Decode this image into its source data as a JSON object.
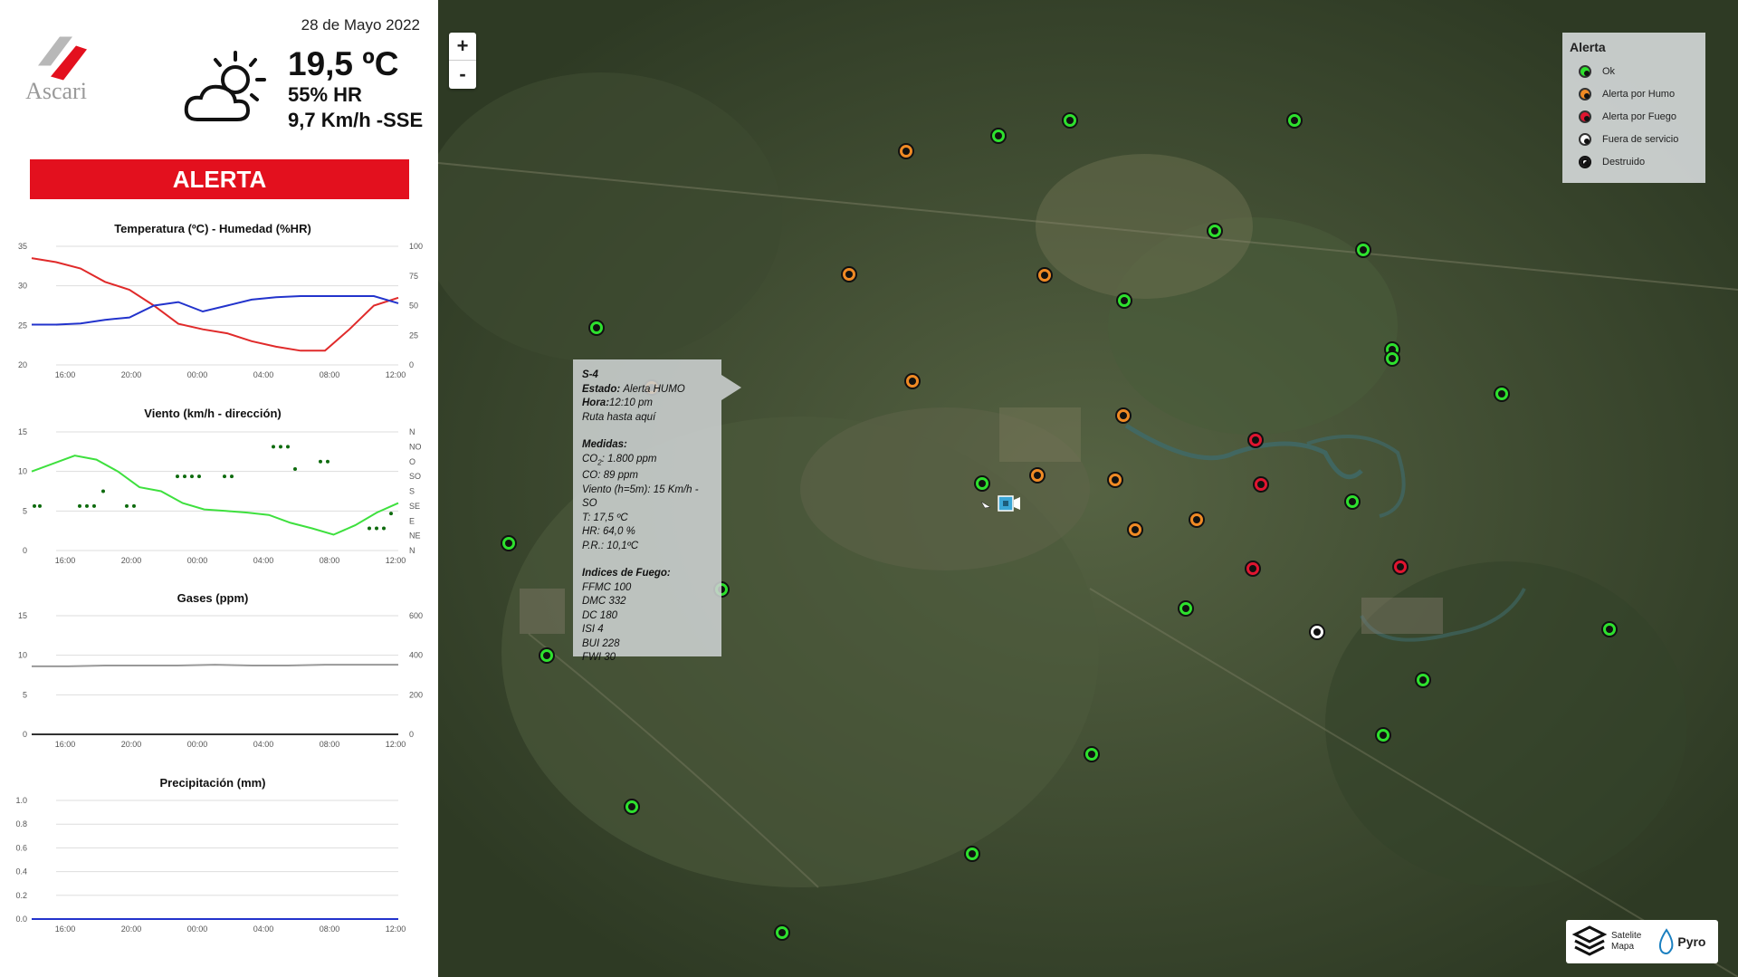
{
  "header": {
    "logo_text": "Ascari",
    "date": "28 de Mayo 2022",
    "temperature": "19,5 ºC",
    "humidity": "55% HR",
    "wind": "9,7 Km/h -SSE",
    "weather_icon": "partly-cloudy-icon"
  },
  "alert_banner": {
    "label": "ALERTA",
    "color": "#e3101e"
  },
  "charts": {
    "temp_humidity": {
      "title": "Temperatura (ºC) - Humedad (%HR)",
      "type": "line",
      "x_ticks": [
        "16:00",
        "20:00",
        "00:00",
        "04:00",
        "08:00",
        "12:00"
      ],
      "y_left_ticks": [
        "35",
        "30",
        "25",
        "20"
      ],
      "y_right_ticks": [
        "100",
        "75",
        "50",
        "25",
        "0"
      ],
      "series": [
        {
          "name": "Temperatura",
          "color": "#e02a2a",
          "values": [
            33.5,
            33.0,
            32.2,
            30.5,
            29.5,
            27.5,
            25.2,
            24.5,
            24.0,
            23.0,
            22.3,
            21.8,
            21.8,
            24.5,
            27.5,
            28.5
          ]
        },
        {
          "name": "Humedad",
          "color": "#2233cc",
          "values": [
            34,
            34,
            35,
            38,
            40,
            50,
            53,
            45,
            50,
            55,
            57,
            58,
            58,
            58,
            58,
            52
          ]
        }
      ]
    },
    "wind": {
      "title": "Viento (km/h - dirección)",
      "type": "line",
      "x_ticks": [
        "16:00",
        "20:00",
        "00:00",
        "04:00",
        "08:00",
        "12:00"
      ],
      "y_left_ticks": [
        "15",
        "10",
        "5",
        "0"
      ],
      "y_right_ticks": [
        "N",
        "NO",
        "O",
        "SO",
        "S",
        "SE",
        "E",
        "NE",
        "N"
      ],
      "speed_color": "#3ee03e",
      "direction_color": "#0e6b0e",
      "speed_values": [
        10,
        11,
        12,
        11.5,
        10,
        8,
        7.5,
        6,
        5.2,
        5,
        4.8,
        4.5,
        3.5,
        2.8,
        2,
        3.2,
        4.8,
        6
      ]
    },
    "gases": {
      "title": "Gases (ppm)",
      "type": "line",
      "x_ticks": [
        "16:00",
        "20:00",
        "00:00",
        "04:00",
        "08:00",
        "12:00"
      ],
      "y_left_ticks": [
        "15",
        "10",
        "5",
        "0"
      ],
      "y_right_ticks": [
        "600",
        "400",
        "200",
        "0"
      ],
      "series": [
        {
          "name": "CO2",
          "color": "#999999",
          "values": [
            8.6,
            8.6,
            8.7,
            8.7,
            8.7,
            8.8,
            8.7,
            8.7,
            8.8,
            8.8,
            8.8
          ]
        },
        {
          "name": "CO",
          "color": "#333333",
          "values": [
            0,
            0,
            0,
            0,
            0,
            0,
            0,
            0,
            0,
            0,
            0
          ]
        }
      ]
    },
    "precipitation": {
      "title": "Precipitación (mm)",
      "type": "line",
      "x_ticks": [
        "16:00",
        "20:00",
        "00:00",
        "04:00",
        "08:00",
        "12:00"
      ],
      "y_left_ticks": [
        "1.0",
        "0.8",
        "0.6",
        "0.4",
        "0.2",
        "0.0"
      ],
      "series": [
        {
          "name": "Precipitación",
          "color": "#2233cc",
          "values": [
            0,
            0,
            0,
            0,
            0,
            0,
            0
          ]
        }
      ]
    }
  },
  "map": {
    "zoom_in": "+",
    "zoom_out": "-",
    "popup": {
      "id": "S-4",
      "estado_label": "Estado:",
      "estado": "Alerta HUMO",
      "hora_label": "Hora:",
      "hora": "12:10 pm",
      "ruta": "Ruta hasta aquí",
      "medidas_label": "Medidas:",
      "co2": "CO",
      "co2_sub": "2",
      "co2_val": ": 1.800 ppm",
      "co": "CO: 89 ppm",
      "viento": "Viento (h=5m): 15 Km/h - SO",
      "t": "T: 17,5 ºC",
      "hr": "HR: 64,0 %",
      "pr": "P.R.: 10,1ºC",
      "indices_label": "Indices de Fuego:",
      "ffmc": "FFMC 100",
      "dmc": "DMC 332",
      "dc": "DC 180",
      "isi": "ISI 4",
      "bui": "BUI 228",
      "fwi": "FWI 30"
    },
    "legend": {
      "title": "Alerta",
      "items": [
        {
          "label": "Ok",
          "color": "#2ee02e"
        },
        {
          "label": "Alerta por Humo",
          "color": "#f08a24"
        },
        {
          "label": "Alerta por Fuego",
          "color": "#e01530"
        },
        {
          "label": "Fuera de servicio",
          "color": "#ffffff"
        },
        {
          "label": "Destruido",
          "color": "#ffffff"
        }
      ]
    },
    "basemap": {
      "label_line1": "Satelite",
      "label_line2": "Mapa",
      "brand": "Pyro",
      "layers_icon": "layers-icon",
      "drop_icon": "flame-drop-icon"
    },
    "markers": [
      {
        "status": "ok",
        "color": "#2ee02e"
      },
      {
        "status": "ok",
        "color": "#2ee02e"
      },
      {
        "status": "ok",
        "color": "#2ee02e"
      },
      {
        "status": "ok",
        "color": "#2ee02e"
      },
      {
        "status": "ok",
        "color": "#2ee02e"
      },
      {
        "status": "ok",
        "color": "#2ee02e"
      },
      {
        "status": "ok",
        "color": "#2ee02e"
      },
      {
        "status": "ok",
        "color": "#2ee02e"
      },
      {
        "status": "ok",
        "color": "#2ee02e"
      },
      {
        "status": "ok",
        "color": "#2ee02e"
      },
      {
        "status": "ok",
        "color": "#2ee02e"
      },
      {
        "status": "ok",
        "color": "#2ee02e"
      },
      {
        "status": "ok",
        "color": "#2ee02e"
      },
      {
        "status": "ok",
        "color": "#2ee02e"
      },
      {
        "status": "ok",
        "color": "#2ee02e"
      },
      {
        "status": "ok",
        "color": "#2ee02e"
      },
      {
        "status": "ok",
        "color": "#2ee02e"
      },
      {
        "status": "ok",
        "color": "#2ee02e"
      },
      {
        "status": "ok",
        "color": "#2ee02e"
      },
      {
        "status": "ok",
        "color": "#2ee02e"
      },
      {
        "status": "ok",
        "color": "#2ee02e"
      },
      {
        "status": "ok",
        "color": "#2ee02e"
      },
      {
        "status": "ok",
        "color": "#2ee02e"
      },
      {
        "status": "smoke",
        "color": "#f08a24"
      },
      {
        "status": "smoke",
        "color": "#f08a24"
      },
      {
        "status": "smoke",
        "color": "#f08a24"
      },
      {
        "status": "smoke",
        "color": "#f08a24"
      },
      {
        "status": "smoke",
        "color": "#f08a24"
      },
      {
        "status": "smoke",
        "color": "#f08a24"
      },
      {
        "status": "smoke",
        "color": "#f08a24"
      },
      {
        "status": "smoke",
        "color": "#f08a24"
      },
      {
        "status": "smoke",
        "color": "#f08a24"
      },
      {
        "status": "smoke",
        "color": "#f08a24"
      },
      {
        "status": "fire",
        "color": "#e01530"
      },
      {
        "status": "fire",
        "color": "#e01530"
      },
      {
        "status": "fire",
        "color": "#e01530"
      },
      {
        "status": "fire",
        "color": "#e01530"
      },
      {
        "status": "out",
        "color": "#ffffff"
      }
    ]
  }
}
